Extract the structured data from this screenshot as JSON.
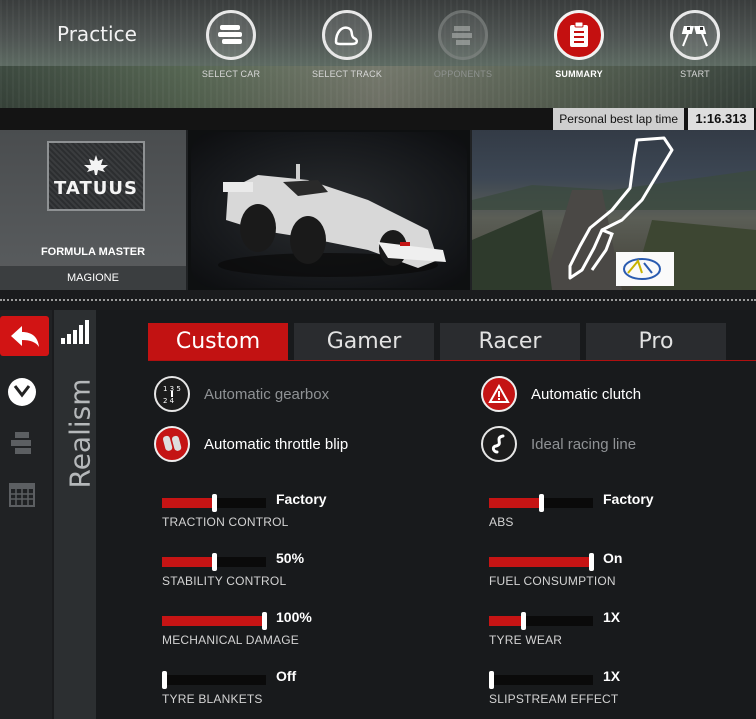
{
  "header": {
    "mode_title": "Practice",
    "steps": [
      {
        "label": "SELECT CAR",
        "icon": "cars-icon",
        "state": "normal"
      },
      {
        "label": "SELECT TRACK",
        "icon": "track-icon",
        "state": "normal"
      },
      {
        "label": "OPPONENTS",
        "icon": "opponents-icon",
        "state": "disabled"
      },
      {
        "label": "SUMMARY",
        "icon": "clipboard-icon",
        "state": "active"
      },
      {
        "label": "START",
        "icon": "checkered-flags-icon",
        "state": "normal"
      }
    ]
  },
  "personal_best": {
    "label": "Personal best lap time",
    "time": "1:16.313"
  },
  "summary": {
    "brand": "TATUUS",
    "car": "FORMULA MASTER",
    "track": "MAGIONE"
  },
  "sidebar": {
    "back_icon": "back-arrow-icon",
    "icons": [
      "clock-icon",
      "cars-icon",
      "calendar-icon"
    ],
    "realism_label": "Realism",
    "realism_icon": "signal-bars-icon"
  },
  "realism": {
    "tabs": [
      "Custom",
      "Gamer",
      "Racer",
      "Pro"
    ],
    "active_tab": "Custom",
    "assists": [
      {
        "label": "Automatic gearbox",
        "icon": "gearbox-icon",
        "enabled": false
      },
      {
        "label": "Automatic clutch",
        "icon": "warning-icon",
        "enabled": true
      },
      {
        "label": "Automatic throttle blip",
        "icon": "pedals-icon",
        "enabled": true
      },
      {
        "label": "Ideal racing line",
        "icon": "racing-line-icon",
        "enabled": false
      }
    ],
    "settings": [
      {
        "name": "TRACTION CONTROL",
        "value": "Factory",
        "level": 0.5
      },
      {
        "name": "ABS",
        "value": "Factory",
        "level": 0.5
      },
      {
        "name": "STABILITY CONTROL",
        "value": "50%",
        "level": 0.5
      },
      {
        "name": "FUEL CONSUMPTION",
        "value": "On",
        "level": 1.0
      },
      {
        "name": "MECHANICAL DAMAGE",
        "value": "100%",
        "level": 1.0
      },
      {
        "name": "TYRE WEAR",
        "value": "1X",
        "level": 0.33
      },
      {
        "name": "TYRE BLANKETS",
        "value": "Off",
        "level": 0.0
      },
      {
        "name": "SLIPSTREAM EFFECT",
        "value": "1X",
        "level": 0.0
      }
    ]
  },
  "colors": {
    "accent": "#c41414",
    "panel": "#181a1c",
    "tab": "#2a2c2f"
  }
}
